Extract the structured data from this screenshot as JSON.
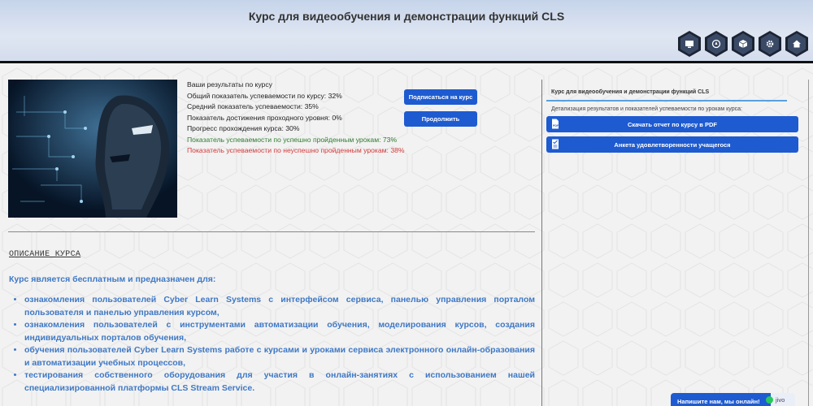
{
  "header": {
    "title": "Курс для видеообучения и демонстрации функций CLS",
    "icons": [
      "monitor-icon",
      "compass-icon",
      "cube-icon",
      "settings-icon",
      "home-icon"
    ]
  },
  "results": {
    "heading": "Ваши результаты по курсу",
    "overall": "Общий показатель успеваемости по курсу: 32%",
    "average": "Средний показатель успеваемости: 35%",
    "passing": "Показатель достижения проходного уровня: 0%",
    "progress": "Прогресс прохождения курса: 30%",
    "success": "Показатель успеваемости по успешно пройденным урокам: 73%",
    "fail": "Показатель успеваемости по неуспешно пройденным урокам: 38%"
  },
  "buttons": {
    "subscribe": "Подписаться на курс",
    "continue": "Продолжить"
  },
  "description": {
    "heading": "ОПИСАНИЕ КУРСА",
    "intro": "Курс является бесплатным и предназначен для:",
    "items": [
      "ознакомления пользователей Cyber Learn Systems с интерфейсом сервиса, панелью управления порталом пользователя и панелью управления курсом,",
      "ознакомления пользователей с инструментами автоматизации обучения, моделирования курсов, создания индивидуальных порталов обучения,",
      "обучения пользователей Cyber Learn Systems работе с курсами и уроками сервиса электронного онлайн-образования и автоматизации учебных процессов,",
      "тестирования собственного оборудования для участия в онлайн-занятиях с использованием нашей специализированной платформы CLS Stream Service."
    ]
  },
  "sidebar": {
    "title": "Курс для видеообучения и демонстрации функций CLS",
    "desc": "Детализация результатов и показателей успеваемости по урокам курса:",
    "btn_pdf": "Скачать отчет по курсу в PDF",
    "btn_survey": "Анкета удовлетворенности учащегося"
  },
  "chat": {
    "label": "Напишите нам, мы онлайн!",
    "tail": "јivo"
  },
  "colors": {
    "accent": "#1e5bd0",
    "link_text": "#3f78c4",
    "success": "#2f7d2f",
    "fail": "#d43a3a"
  }
}
